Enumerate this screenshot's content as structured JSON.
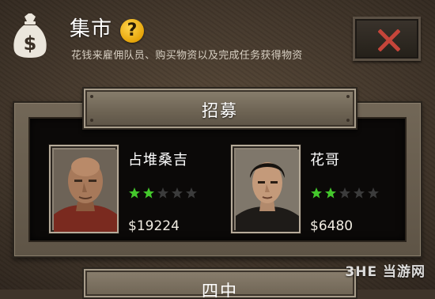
{
  "header": {
    "title": "集市",
    "help_symbol": "?",
    "subtitle": "花钱来雇佣队员、购买物资以及完成任务获得物资",
    "close_icon": "close-x-icon",
    "bag_icon": "money-bag-icon"
  },
  "recruit_section": {
    "title": "招募",
    "recruits": [
      {
        "name": "占堆桑吉",
        "stars_filled": 2,
        "stars_total": 5,
        "price": "$19224"
      },
      {
        "name": "花哥",
        "stars_filled": 2,
        "stars_total": 5,
        "price": "$6480"
      }
    ]
  },
  "next_section": {
    "title": "四中"
  },
  "watermark": {
    "text": "3HE 当游网"
  },
  "colors": {
    "accent_gold": "#e6a50a",
    "close_red": "#c5453a",
    "star_green": "#44c82c",
    "star_empty": "#3b3b3b"
  }
}
